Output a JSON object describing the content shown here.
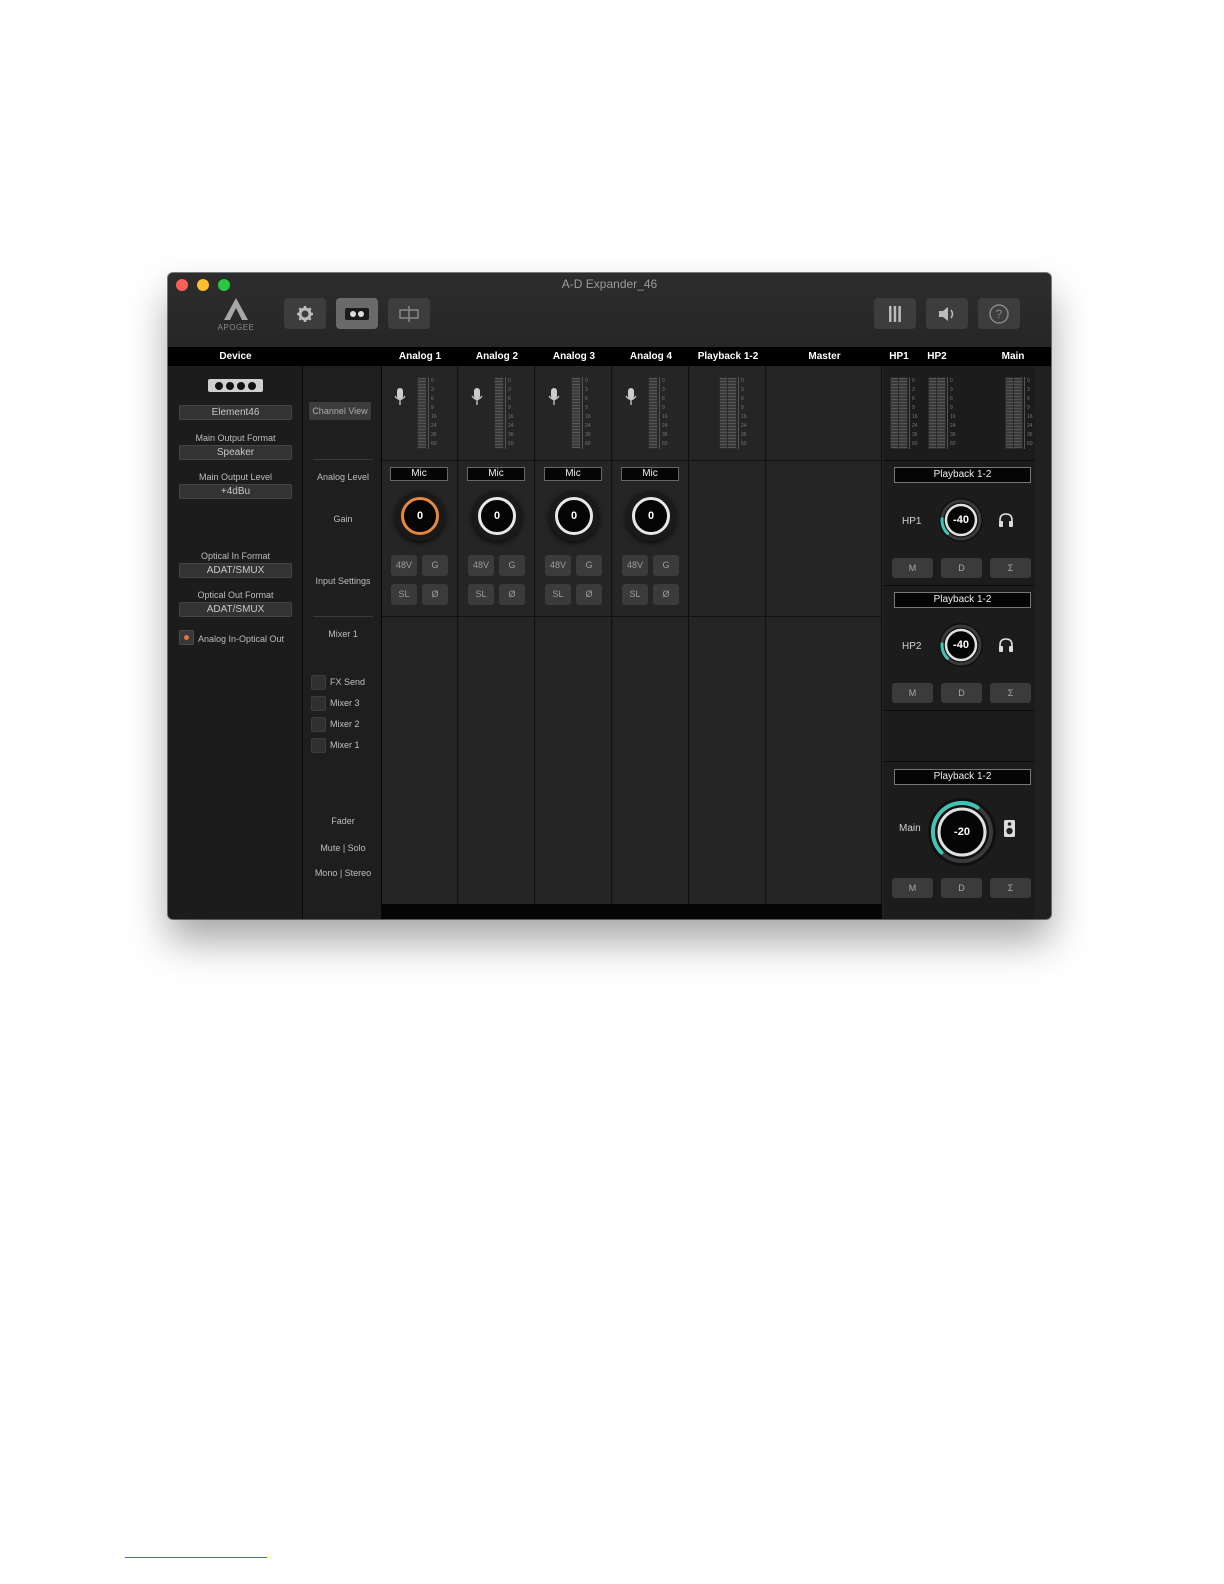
{
  "window": {
    "title": "A-D Expander_46"
  },
  "logo": {
    "text": "APOGEE"
  },
  "toolbar": {
    "settings_icon": "gear-icon",
    "view_icon": "mixer-view-icon",
    "routing_icon": "routing-icon",
    "meters_icon": "meters-icon",
    "speaker_icon": "speaker-icon",
    "help_icon": "help-icon"
  },
  "columns": {
    "device": "Device",
    "analog1": "Analog 1",
    "analog2": "Analog 2",
    "analog3": "Analog 3",
    "analog4": "Analog 4",
    "playback": "Playback 1-2",
    "master": "Master",
    "hp1": "HP1",
    "hp2": "HP2",
    "main": "Main"
  },
  "device": {
    "name": "Element46",
    "main_output_format_label": "Main Output Format",
    "main_output_format": "Speaker",
    "main_output_level_label": "Main Output Level",
    "main_output_level": "+4dBu",
    "optical_in_label": "Optical In Format",
    "optical_in": "ADAT/SMUX",
    "optical_out_label": "Optical Out Format",
    "optical_out": "ADAT/SMUX",
    "analog_optical_label": "Analog In-Optical Out"
  },
  "rows": {
    "channel_view": "Channel View",
    "analog_level": "Analog Level",
    "gain": "Gain",
    "input_settings": "Input Settings",
    "mixer1": "Mixer 1",
    "fx_send": "FX Send",
    "mixer3": "Mixer 3",
    "mixer2": "Mixer 2",
    "mixer1b": "Mixer 1",
    "fader": "Fader",
    "mute_solo": "Mute | Solo",
    "mono_stereo": "Mono | Stereo"
  },
  "meter_scale": [
    "0",
    "3",
    "6",
    "9",
    "16",
    "24",
    "36",
    "60"
  ],
  "channels": [
    {
      "source": "Mic",
      "gain": "0",
      "btn_48v": "48V",
      "btn_g": "G",
      "btn_sl": "SL",
      "btn_phase": "Ø"
    },
    {
      "source": "Mic",
      "gain": "0",
      "btn_48v": "48V",
      "btn_g": "G",
      "btn_sl": "SL",
      "btn_phase": "Ø"
    },
    {
      "source": "Mic",
      "gain": "0",
      "btn_48v": "48V",
      "btn_g": "G",
      "btn_sl": "SL",
      "btn_phase": "Ø"
    },
    {
      "source": "Mic",
      "gain": "0",
      "btn_48v": "48V",
      "btn_g": "G",
      "btn_sl": "SL",
      "btn_phase": "Ø"
    }
  ],
  "outputs": {
    "hp1": {
      "source": "Playback 1-2",
      "label": "HP1",
      "level": "-40",
      "level_fraction": 0.18,
      "btn_m": "M",
      "btn_d": "D",
      "btn_sum": "Σ"
    },
    "hp2": {
      "source": "Playback 1-2",
      "label": "HP2",
      "level": "-40",
      "level_fraction": 0.18,
      "btn_m": "M",
      "btn_d": "D",
      "btn_sum": "Σ"
    },
    "main": {
      "source": "Playback 1-2",
      "label": "Main",
      "level": "-20",
      "level_fraction": 0.62,
      "btn_m": "M",
      "btn_d": "D",
      "btn_sum": "Σ"
    }
  },
  "colors": {
    "accent_orange": "#e6883e",
    "accent_teal": "#3ec3b4"
  }
}
